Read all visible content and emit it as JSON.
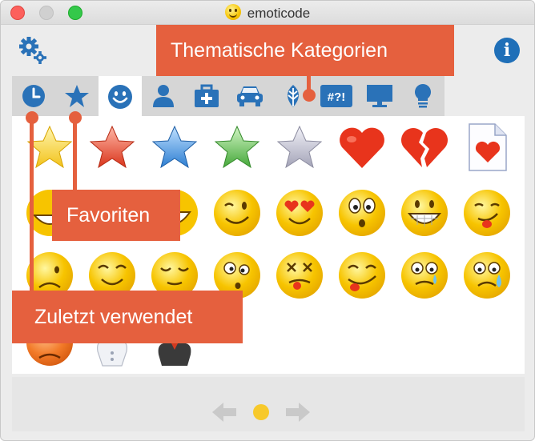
{
  "window": {
    "title": "emoticode"
  },
  "toolbar": {
    "settings_icon": "gear-icon",
    "info_icon": "info-icon",
    "info_glyph": "i"
  },
  "tabs": [
    {
      "id": "recent",
      "icon": "clock-icon"
    },
    {
      "id": "favorites",
      "icon": "star-icon"
    },
    {
      "id": "smileys",
      "icon": "smiley-icon",
      "active": true
    },
    {
      "id": "people",
      "icon": "person-icon"
    },
    {
      "id": "medical",
      "icon": "medkit-icon"
    },
    {
      "id": "vehicles",
      "icon": "car-icon"
    },
    {
      "id": "nature",
      "icon": "leaf-icon"
    },
    {
      "id": "symbols",
      "icon": "symbols-icon",
      "label": "#?!"
    },
    {
      "id": "objects",
      "icon": "monitor-icon"
    },
    {
      "id": "ideas",
      "icon": "lightbulb-icon"
    }
  ],
  "emoji_grid": {
    "rows": [
      [
        "star-yellow",
        "star-red",
        "star-blue",
        "star-green",
        "star-gray",
        "heart",
        "broken-heart",
        "heart-document"
      ],
      [
        "smiley-grin",
        "smiley-wide-grin",
        "smiley-big-laugh",
        "smiley-wink",
        "smiley-heart-eyes",
        "smiley-surprised",
        "smiley-toothy-grin",
        "smiley-tongue"
      ],
      [
        "smiley-worried",
        "smiley-content",
        "smiley-relieved",
        "smiley-confused",
        "smiley-dizzy",
        "smiley-tongue-wink",
        "smiley-tear",
        "smiley-crying"
      ],
      [
        "smiley-angry",
        "chef-figure",
        "ninja-figure"
      ]
    ]
  },
  "pager": {
    "current_page": 1,
    "total_pages": 1
  },
  "annotations": {
    "categories": "Thematische Kategorien",
    "favorites": "Favoriten",
    "recent": "Zuletzt verwendet"
  },
  "colors": {
    "accent": "#e5603e",
    "info_blue": "#1f6fb8",
    "tab_icon_blue": "#2a72b8",
    "page_dot": "#f7c92b"
  }
}
